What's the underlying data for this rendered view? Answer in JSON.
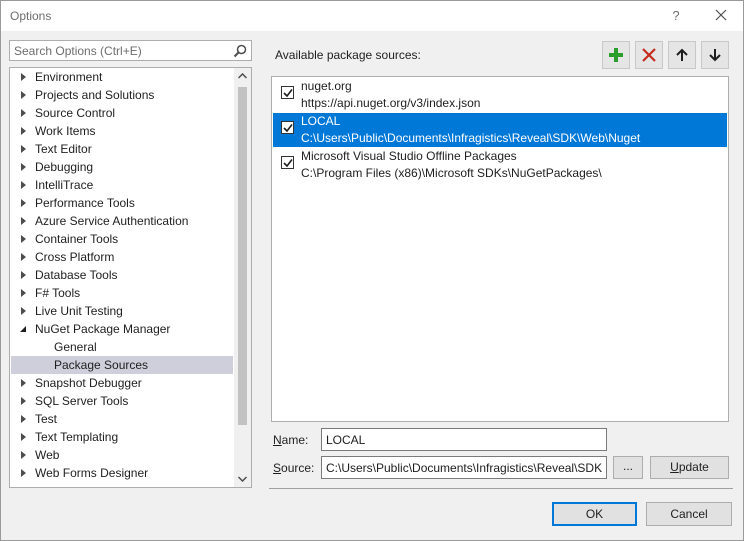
{
  "window": {
    "title": "Options",
    "help_label": "?"
  },
  "search": {
    "placeholder": "Search Options (Ctrl+E)"
  },
  "tree": {
    "items": [
      {
        "label": "Environment",
        "state": "collapsed"
      },
      {
        "label": "Projects and Solutions",
        "state": "collapsed"
      },
      {
        "label": "Source Control",
        "state": "collapsed"
      },
      {
        "label": "Work Items",
        "state": "collapsed"
      },
      {
        "label": "Text Editor",
        "state": "collapsed"
      },
      {
        "label": "Debugging",
        "state": "collapsed"
      },
      {
        "label": "IntelliTrace",
        "state": "collapsed"
      },
      {
        "label": "Performance Tools",
        "state": "collapsed"
      },
      {
        "label": "Azure Service Authentication",
        "state": "collapsed"
      },
      {
        "label": "Container Tools",
        "state": "collapsed"
      },
      {
        "label": "Cross Platform",
        "state": "collapsed"
      },
      {
        "label": "Database Tools",
        "state": "collapsed"
      },
      {
        "label": "F# Tools",
        "state": "collapsed"
      },
      {
        "label": "Live Unit Testing",
        "state": "collapsed"
      },
      {
        "label": "NuGet Package Manager",
        "state": "expanded"
      },
      {
        "label": "General",
        "state": "child"
      },
      {
        "label": "Package Sources",
        "state": "child-selected"
      },
      {
        "label": "Snapshot Debugger",
        "state": "collapsed"
      },
      {
        "label": "SQL Server Tools",
        "state": "collapsed"
      },
      {
        "label": "Test",
        "state": "collapsed"
      },
      {
        "label": "Text Templating",
        "state": "collapsed"
      },
      {
        "label": "Web",
        "state": "collapsed"
      },
      {
        "label": "Web Forms Designer",
        "state": "collapsed"
      }
    ]
  },
  "panel": {
    "available_label": "Available package sources:",
    "toolbar": {
      "add": "add-icon",
      "remove": "remove-icon",
      "up": "arrow-up-icon",
      "down": "arrow-down-icon",
      "add_color": "#2a9d2a",
      "remove_color": "#c42b1c"
    },
    "sources": [
      {
        "name": "nuget.org",
        "url": "https://api.nuget.org/v3/index.json",
        "checked": true,
        "selected": false
      },
      {
        "name": "LOCAL",
        "url": "C:\\Users\\Public\\Documents\\Infragistics\\Reveal\\SDK\\Web\\Nuget",
        "checked": true,
        "selected": true
      },
      {
        "name": "Microsoft Visual Studio Offline Packages",
        "url": "C:\\Program Files (x86)\\Microsoft SDKs\\NuGetPackages\\",
        "checked": true,
        "selected": false
      }
    ],
    "name_label_u": "N",
    "name_label_rest": "ame:",
    "name_value": "LOCAL",
    "source_label_u": "S",
    "source_label_rest": "ource:",
    "source_value": "C:\\Users\\Public\\Documents\\Infragistics\\Reveal\\SDK\\",
    "browse_label": "...",
    "update_label_u": "U",
    "update_label_rest": "pdate"
  },
  "footer": {
    "ok_label": "OK",
    "cancel_label": "Cancel"
  },
  "colors": {
    "selection_blue": "#0078d7",
    "tree_selection": "#cfcfdc"
  }
}
